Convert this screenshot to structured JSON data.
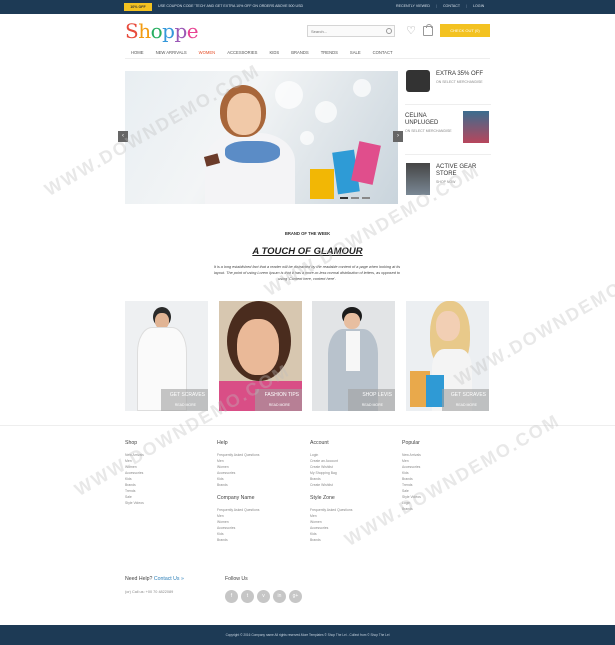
{
  "topbar": {
    "badge": "10% OFF",
    "promo": "USE COUPON CODE 'TECH' AND GET EXTRA 10% OFF ON ORDERS ABOVE 500 USD",
    "links": [
      "RECENTLY VIEWED",
      "CONTACT",
      "LOGIN"
    ]
  },
  "header": {
    "logo": [
      "S",
      "h",
      "o",
      "p",
      "p",
      "e"
    ],
    "search_placeholder": "Search...",
    "checkout_label": "CHECK OUT (0)"
  },
  "nav": [
    "HOME",
    "NEW ARRIVALS",
    "WOMEN",
    "ACCESSORIES",
    "KIDS",
    "BRANDS",
    "TRENDS",
    "SALE",
    "CONTACT"
  ],
  "nav_active": "WOMEN",
  "promos": [
    {
      "title": "EXTRA 35% OFF",
      "sub": "ON SELECT MERCHANDISE"
    },
    {
      "title": "CELINA UNPLUGED",
      "sub": "ON SELECT MERCHANDISE"
    },
    {
      "title": "ACTIVE GEAR STORE",
      "sub": "SHOP NOW"
    }
  ],
  "brand_of_week": {
    "label": "BRAND OF THE WEEK",
    "title": "A TOUCH OF GLAMOUR",
    "text": "It is a long established fact that a reader will be distracted by the readable content of a page when looking at its layout. The point of using Lorem Ipsum is that it has a more-or-less normal distribution of letters, as opposed to using 'Content here, content here'."
  },
  "tiles": [
    {
      "label": "GET SCRAVES",
      "more": "READ MORE"
    },
    {
      "label": "FASHION TIPS",
      "more": "READ MORE"
    },
    {
      "label": "SHOP LEVIS",
      "more": "READ MORE"
    },
    {
      "label": "GET SCRAVES",
      "more": "READ MORE"
    }
  ],
  "footer": {
    "shop": {
      "title": "Shop",
      "items": [
        "New Arrivals",
        "Men",
        "Women",
        "Accessories",
        "Kids",
        "Brands",
        "Trends",
        "Sale",
        "Style Videos"
      ]
    },
    "help": {
      "title": "Help",
      "items": [
        "Frequently Asked Questions",
        "Men",
        "Women",
        "Accessories",
        "Kids",
        "Brands"
      ]
    },
    "company": {
      "title": "Company Name",
      "items": [
        "Frequently Asked Questions",
        "Men",
        "Women",
        "Accessories",
        "Kids",
        "Brands"
      ]
    },
    "account": {
      "title": "Account",
      "items": [
        "Login",
        "Create an Account",
        "Create Wishlist",
        "My Shopping Bag",
        "Brands",
        "Create Wishlist"
      ]
    },
    "style_zone": {
      "title": "Style Zone",
      "items": [
        "Frequently Asked Questions",
        "Men",
        "Women",
        "Accessories",
        "Kids",
        "Brands"
      ]
    },
    "popular": {
      "title": "Popular",
      "items": [
        "New Arrivals",
        "Men",
        "Accessories",
        "Kids",
        "Brands",
        "Trends",
        "Sale",
        "Style Videos",
        "Login",
        "Brands"
      ]
    },
    "need_help": "Need Help?",
    "contact_us": "Contact Us »",
    "call": "(or) Call us: +00 70 4822089",
    "follow_us": "Follow Us",
    "socials": [
      "f",
      "t",
      "v",
      "in",
      "g+"
    ],
    "copyright": "Copyright © 2016 Company name All rights reserved.More Templates © Shop The Lei  -  Collect from © Shop The Lei"
  },
  "watermark": "WWW.DOWNDEMO.COM",
  "colors": {
    "topbar": "#1d3a55",
    "accent": "#f3c221",
    "active_nav": "#e44d26"
  }
}
